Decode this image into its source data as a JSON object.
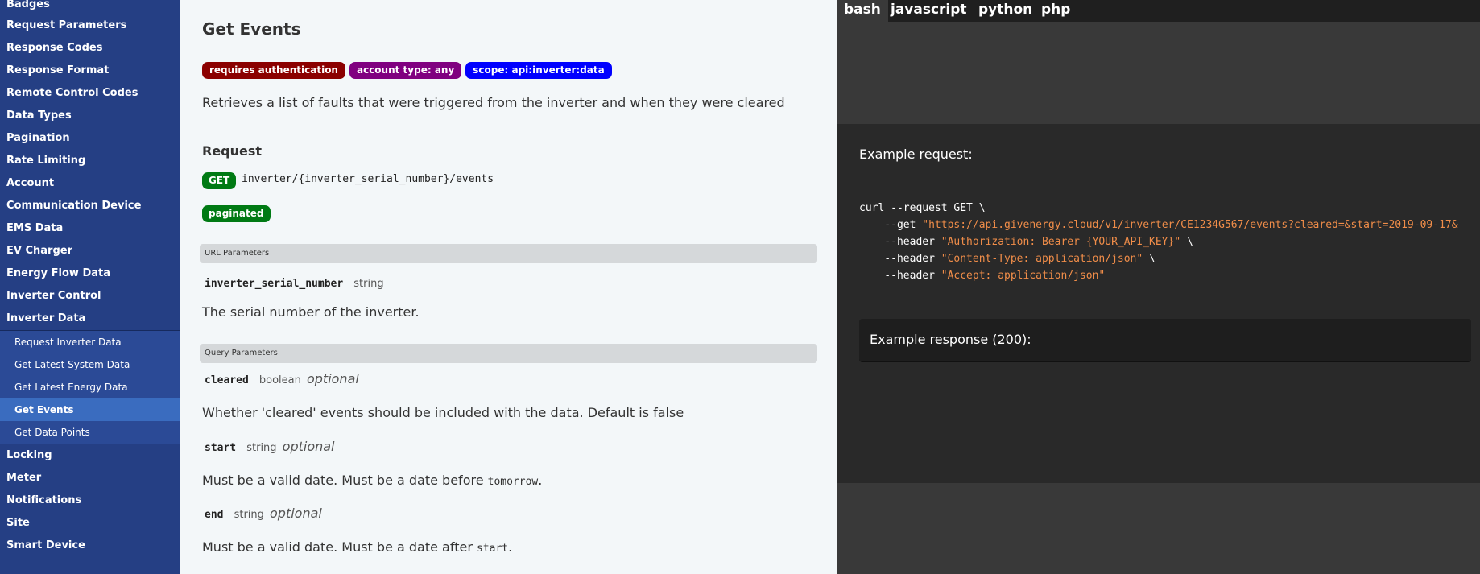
{
  "sidebar": {
    "items_top": [
      "Badges",
      "Request Parameters",
      "Response Codes",
      "Response Format",
      "Remote Control Codes",
      "Data Types",
      "Pagination",
      "Rate Limiting",
      "Account",
      "Communication Device",
      "EMS Data",
      "EV Charger",
      "Energy Flow Data",
      "Inverter Control",
      "Inverter Data"
    ],
    "sub_items": [
      "Request Inverter Data",
      "Get Latest System Data",
      "Get Latest Energy Data",
      "Get Events",
      "Get Data Points"
    ],
    "items_bottom": [
      "Locking",
      "Meter",
      "Notifications",
      "Site",
      "Smart Device"
    ]
  },
  "main": {
    "title": "Get Events",
    "badges": [
      {
        "label": "requires authentication",
        "color": "#8b0000"
      },
      {
        "label": "account type: any",
        "color": "#800080"
      },
      {
        "label": "scope: api:inverter:data",
        "color": "#0000ff"
      }
    ],
    "description": "Retrieves a list of faults that were triggered from the inverter and when they were cleared",
    "request_title": "Request",
    "method": "GET",
    "endpoint": "inverter/{inverter_serial_number}/events",
    "paginated": "paginated",
    "url_params_title": "URL Parameters",
    "query_params_title": "Query Parameters",
    "url_params": [
      {
        "name": "inverter_serial_number",
        "type": "string",
        "description": "The serial number of the inverter."
      }
    ],
    "query_params": [
      {
        "name": "cleared",
        "type": "boolean",
        "optional": "optional",
        "description": "Whether 'cleared' events should be included with the data. Default is false"
      },
      {
        "name": "start",
        "type": "string",
        "optional": "optional",
        "desc_prefix": "Must be a valid date. Must be a date before ",
        "desc_code": "tomorrow",
        "desc_suffix": "."
      },
      {
        "name": "end",
        "type": "string",
        "optional": "optional",
        "desc_prefix": "Must be a valid date. Must be a date after ",
        "desc_code": "start",
        "desc_suffix": "."
      }
    ]
  },
  "code_panel": {
    "tabs": [
      "bash",
      "javascript",
      "python",
      "php"
    ],
    "active_tab": "bash",
    "example_request_label": "Example request:",
    "code": {
      "line1": "curl --request GET \\",
      "line2_flag": "    --get ",
      "line2_str": "\"https://api.givenergy.cloud/v1/inverter/CE1234G567/events?cleared=&start=2019-09-17&",
      "line3_flag": "    --header ",
      "line3_str": "\"Authorization: Bearer {YOUR_API_KEY}\"",
      "line3_tail": " \\",
      "line4_flag": "    --header ",
      "line4_str": "\"Content-Type: application/json\"",
      "line4_tail": " \\",
      "line5_flag": "    --header ",
      "line5_str": "\"Accept: application/json\""
    },
    "example_response_label": "Example response (200):"
  }
}
